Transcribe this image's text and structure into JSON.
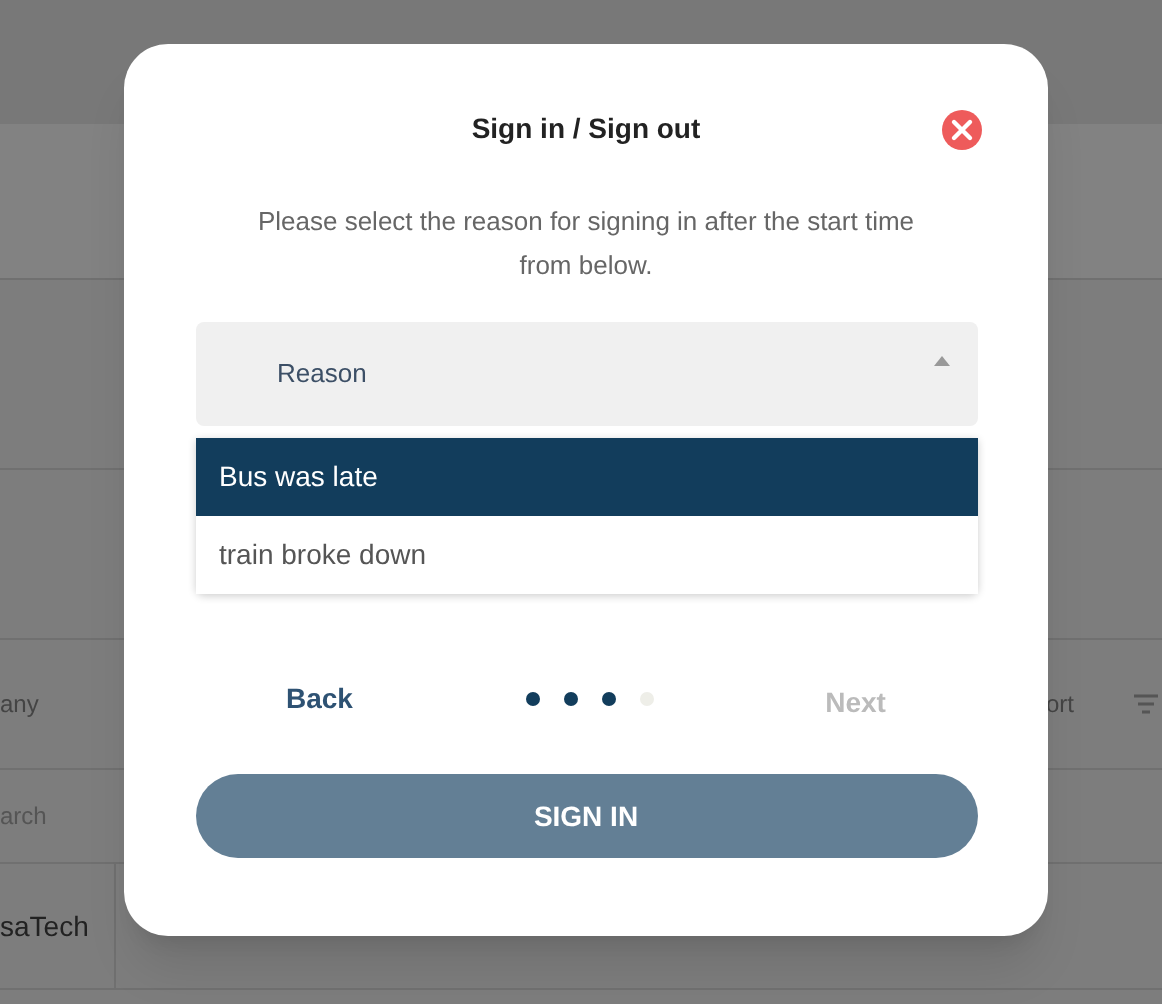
{
  "background_table": {
    "header": {
      "column_1": "any",
      "column_4": "ort"
    },
    "search_row": {
      "column_1": "arch"
    },
    "rows": [
      {
        "column_1": "saTech"
      }
    ]
  },
  "dialog": {
    "title": "Sign in / Sign out",
    "message": "Please select the reason for signing in after the start time from below.",
    "reason_select": {
      "placeholder": "Reason",
      "expanded": true,
      "options": [
        {
          "label": "Bus was late",
          "selected": true
        },
        {
          "label": "train broke down",
          "selected": false
        }
      ]
    },
    "back": {
      "label": "Back"
    },
    "steps": [
      {
        "done": true
      },
      {
        "done": true
      },
      {
        "done": true
      },
      {
        "done": false
      }
    ],
    "next": {
      "label": "Next",
      "disabled": true
    },
    "sign_in": {
      "label": "SIGN IN"
    }
  }
}
